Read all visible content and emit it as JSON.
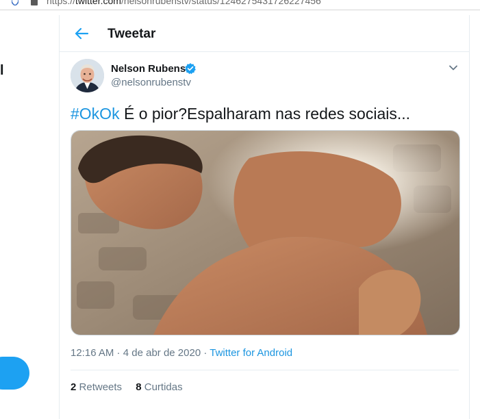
{
  "browser": {
    "url_prefix": "https://",
    "url_domain": "twitter.com",
    "url_path": "/nelsonrubenstv/status/1246275431726227456"
  },
  "sidebar": {
    "partial_label": "l"
  },
  "header": {
    "title": "Tweetar"
  },
  "tweet": {
    "author_name": "Nelson Rubens",
    "author_handle": "@nelsonrubenstv",
    "hashtag": "#OkOk",
    "text": " É o pior?Espalharam nas redes sociais...",
    "time": "12:16 AM",
    "sep": " · ",
    "date": "4 de abr de 2020",
    "source": "Twitter for Android",
    "retweets_count": "2",
    "retweets_label": "Retweets",
    "likes_count": "8",
    "likes_label": "Curtidas"
  },
  "icons": {
    "back": "arrow-left-icon",
    "verified": "verified-badge-icon",
    "caret": "chevron-down-icon"
  },
  "colors": {
    "accent": "#1da1f2",
    "link": "#1b95e0",
    "muted": "#657786",
    "border": "#e6ecf0"
  }
}
